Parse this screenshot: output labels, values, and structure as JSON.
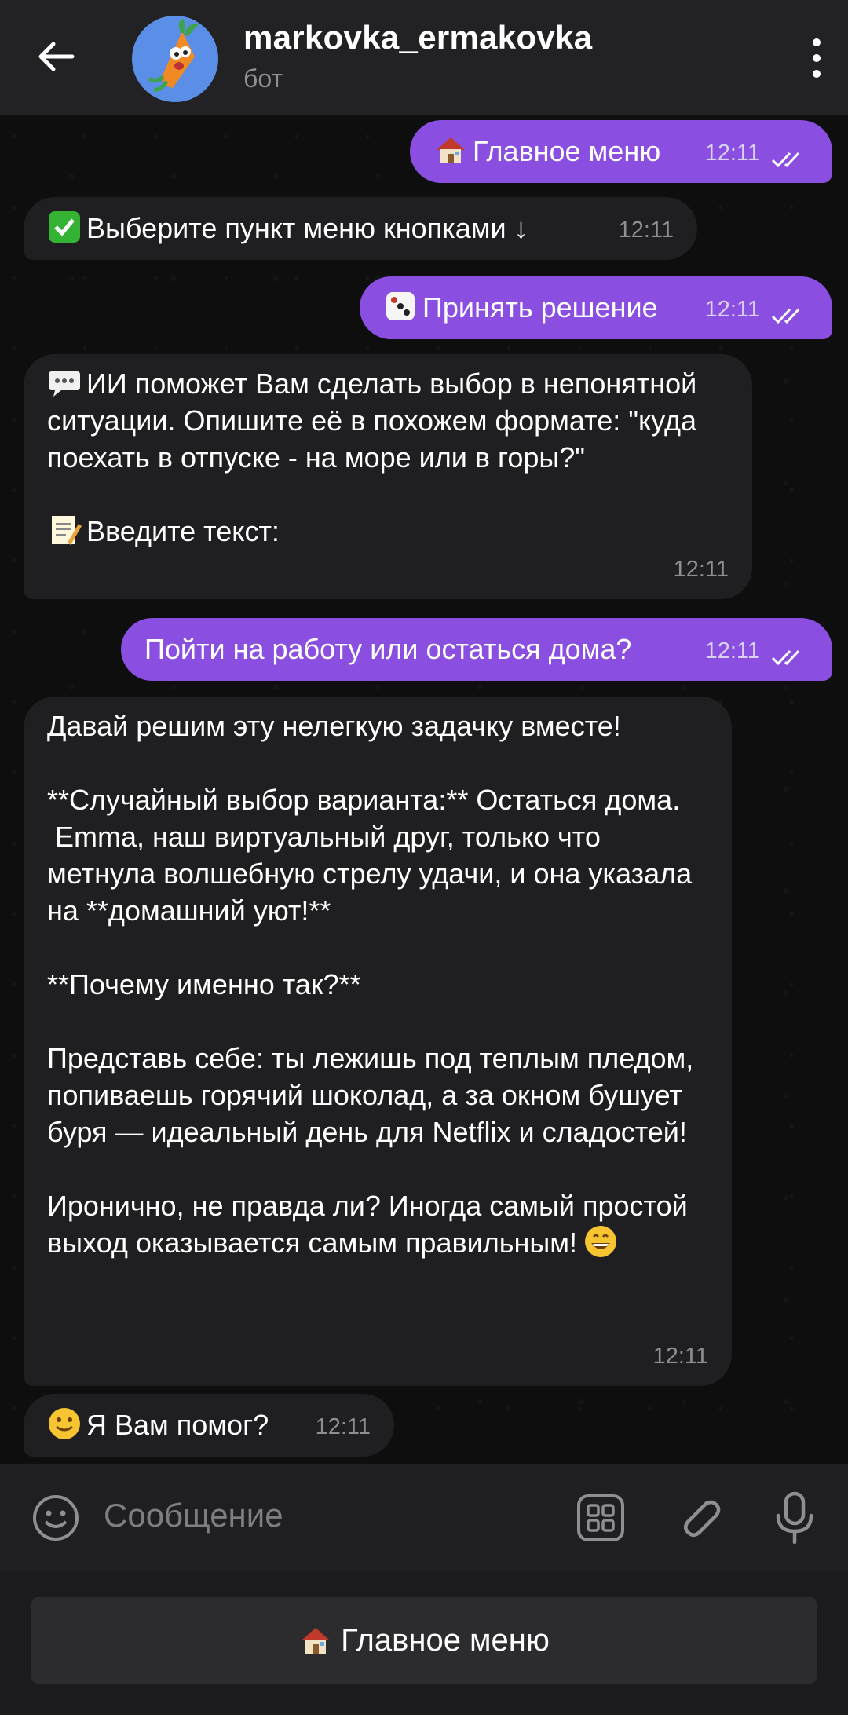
{
  "header": {
    "title": "markovka_ermakovka",
    "subtitle": "бот"
  },
  "messages": [
    {
      "dir": "out",
      "text": "Главное меню",
      "emoji": "house",
      "time": "12:11",
      "read": true
    },
    {
      "dir": "in",
      "text": "Выберите пункт меню кнопками ↓",
      "emoji": "check",
      "time": "12:11"
    },
    {
      "dir": "out",
      "text": "Принять решение",
      "emoji": "dice",
      "time": "12:11",
      "read": true
    },
    {
      "dir": "in",
      "text": "ИИ поможет Вам сделать выбор в непонятной ситуации. Опишите её в похожем формате: \"куда поехать в отпуске - на море или в горы?\"",
      "emoji": "speech",
      "text2": "Введите текст:",
      "emoji2": "memo",
      "time": "12:11"
    },
    {
      "dir": "out",
      "text": "Пойти на работу или остаться дома?",
      "time": "12:11",
      "read": true
    },
    {
      "dir": "in",
      "text": "Давай решим эту нелегкую задачку вместе!\n\n**Случайный выбор варианта:** Остаться дома.\n Emma, наш виртуальный друг, только что метнула волшебную стрелу удачи, и она указала на **домашний уют!**\n\n**Почему именно так?**\n\nПредставь себе: ты лежишь под теплым пледом, попиваешь горячий шоколад, а за окном бушует буря — идеальный день для Netflix и сладостей!\n\nИронично, не правда ли? Иногда самый простой выход оказывается самым правильным!",
      "time": "12:11"
    },
    {
      "dir": "in",
      "text": "Я Вам помог?",
      "emoji": "smile",
      "time": "12:11"
    }
  ],
  "input": {
    "placeholder": "Сообщение"
  },
  "keyboard": {
    "button_label": "Главное меню",
    "button_emoji": "house"
  },
  "colors": {
    "outgoing": "#8a4fe0",
    "incoming": "#1f1f21",
    "header": "#222224"
  }
}
